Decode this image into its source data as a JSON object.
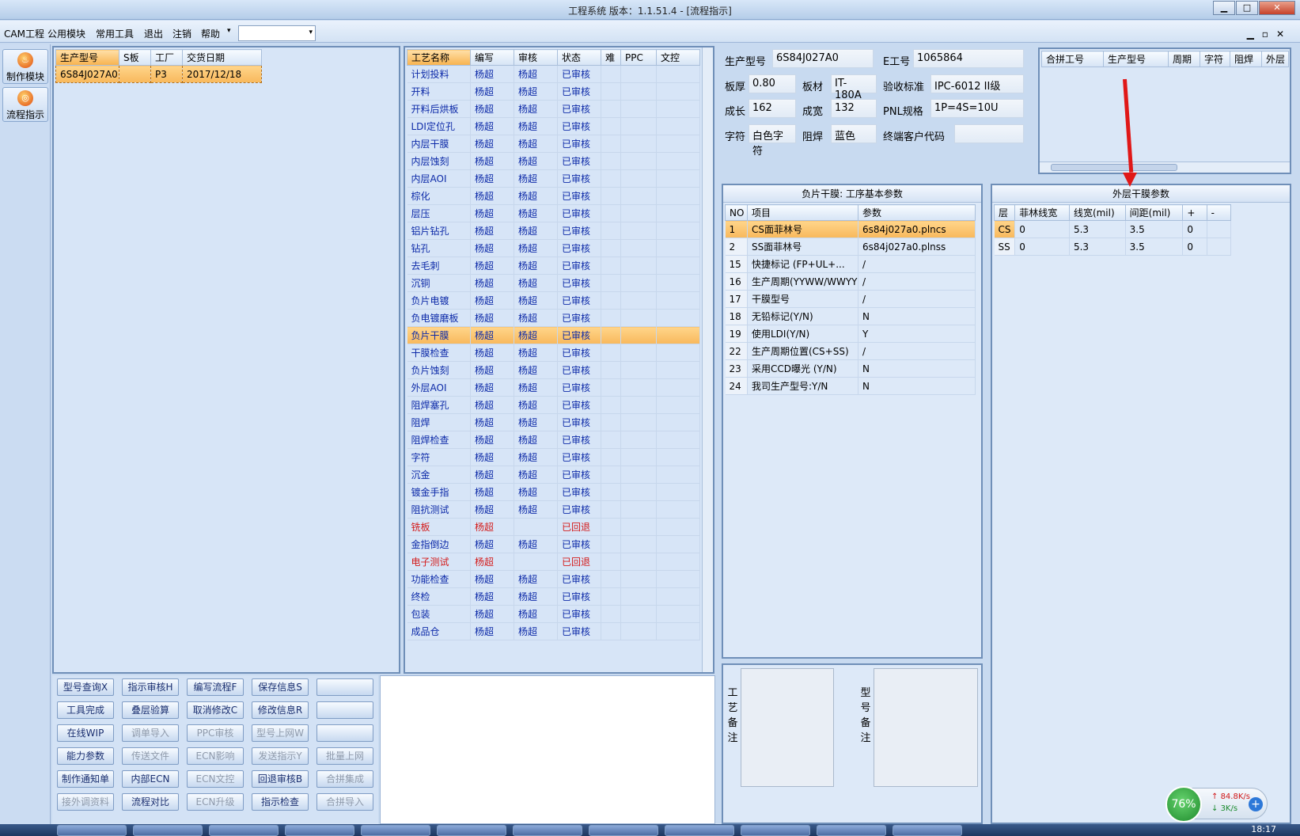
{
  "window": {
    "title": "工程系统   版本：1.1.51.4 - [流程指示]"
  },
  "menu": [
    "CAM工程",
    "公用模块",
    "常用工具",
    "退出",
    "注销",
    "帮助"
  ],
  "left_buttons": [
    "制作模块",
    "流程指示"
  ],
  "order_grid": {
    "headers": [
      "生产型号",
      "S板",
      "工厂",
      "交货日期"
    ],
    "row": [
      "6S84J027A0",
      "",
      "P3",
      "2017/12/18"
    ]
  },
  "process_grid": {
    "headers": [
      "工艺名称",
      "编写",
      "审核",
      "状态",
      "难",
      "PPC",
      "文控"
    ],
    "rows": [
      [
        "计划投料",
        "杨超",
        "杨超",
        "已审核"
      ],
      [
        "开料",
        "杨超",
        "杨超",
        "已审核"
      ],
      [
        "开料后烘板",
        "杨超",
        "杨超",
        "已审核"
      ],
      [
        "LDI定位孔",
        "杨超",
        "杨超",
        "已审核"
      ],
      [
        "内层干膜",
        "杨超",
        "杨超",
        "已审核"
      ],
      [
        "内层蚀刻",
        "杨超",
        "杨超",
        "已审核"
      ],
      [
        "内层AOI",
        "杨超",
        "杨超",
        "已审核"
      ],
      [
        "棕化",
        "杨超",
        "杨超",
        "已审核"
      ],
      [
        "层压",
        "杨超",
        "杨超",
        "已审核"
      ],
      [
        "铝片钻孔",
        "杨超",
        "杨超",
        "已审核"
      ],
      [
        "钻孔",
        "杨超",
        "杨超",
        "已审核"
      ],
      [
        "去毛刺",
        "杨超",
        "杨超",
        "已审核"
      ],
      [
        "沉铜",
        "杨超",
        "杨超",
        "已审核"
      ],
      [
        "负片电镀",
        "杨超",
        "杨超",
        "已审核"
      ],
      [
        "负电镀磨板",
        "杨超",
        "杨超",
        "已审核"
      ],
      [
        "负片干膜",
        "杨超",
        "杨超",
        "已审核"
      ],
      [
        "干膜检查",
        "杨超",
        "杨超",
        "已审核"
      ],
      [
        "负片蚀刻",
        "杨超",
        "杨超",
        "已审核"
      ],
      [
        "外层AOI",
        "杨超",
        "杨超",
        "已审核"
      ],
      [
        "阻焊塞孔",
        "杨超",
        "杨超",
        "已审核"
      ],
      [
        "阻焊",
        "杨超",
        "杨超",
        "已审核"
      ],
      [
        "阻焊检查",
        "杨超",
        "杨超",
        "已审核"
      ],
      [
        "字符",
        "杨超",
        "杨超",
        "已审核"
      ],
      [
        "沉金",
        "杨超",
        "杨超",
        "已审核"
      ],
      [
        "镀金手指",
        "杨超",
        "杨超",
        "已审核"
      ],
      [
        "阻抗测试",
        "杨超",
        "杨超",
        "已审核"
      ],
      [
        "铣板",
        "杨超",
        "",
        "已回退"
      ],
      [
        "金指倒边",
        "杨超",
        "杨超",
        "已审核"
      ],
      [
        "电子测试",
        "杨超",
        "",
        "已回退"
      ],
      [
        "功能检查",
        "杨超",
        "杨超",
        "已审核"
      ],
      [
        "终检",
        "杨超",
        "杨超",
        "已审核"
      ],
      [
        "包装",
        "杨超",
        "杨超",
        "已审核"
      ],
      [
        "成品仓",
        "杨超",
        "杨超",
        "已审核"
      ]
    ],
    "highlighted_index": 15,
    "returned_indexes": [
      26,
      28
    ]
  },
  "info": {
    "prod_model_label": "生产型号",
    "prod_model": "6S84J027A0",
    "e_no_label": "E工号",
    "e_no": "1065864",
    "thickness_label": "板厚",
    "thickness": "0.80",
    "material_label": "板材",
    "material": "IT-180A",
    "standard_label": "验收标准",
    "standard": "IPC-6012 II级",
    "length_label": "成长",
    "length": "162",
    "width_label": "成宽",
    "width": "132",
    "pnl_label": "PNL规格",
    "pnl": "1P=4S=10U",
    "char_label": "字符",
    "char": "白色字符",
    "mask_label": "阻焊",
    "mask": "蓝色",
    "customer_label": "终端客户代码",
    "customer": ""
  },
  "merge_grid": {
    "headers": [
      "合拼工号",
      "生产型号",
      "周期",
      "字符",
      "阻焊",
      "外层"
    ]
  },
  "param_panel": {
    "caption": "负片干膜: 工序基本参数",
    "headers": [
      "NO",
      "项目",
      "参数"
    ],
    "rows": [
      [
        "1",
        "CS面菲林号",
        "6s84j027a0.plncs"
      ],
      [
        "2",
        "SS面菲林号",
        "6s84j027a0.plnss"
      ],
      [
        "15",
        "快捷标记 (FP+UL+...",
        "/"
      ],
      [
        "16",
        "生产周期(YYWW/WWYY)",
        "/"
      ],
      [
        "17",
        "干膜型号",
        "/"
      ],
      [
        "18",
        "无铅标记(Y/N)",
        "N"
      ],
      [
        "19",
        "使用LDI(Y/N)",
        "Y"
      ],
      [
        "22",
        "生产周期位置(CS+SS)",
        "/"
      ],
      [
        "23",
        "采用CCD曝光 (Y/N)",
        "N"
      ],
      [
        "24",
        "我司生产型号:Y/N",
        "N"
      ]
    ]
  },
  "outer_panel": {
    "caption": "外层干膜参数",
    "headers": [
      "层",
      "菲林线宽",
      "线宽(mil)",
      "间距(mil)",
      "+",
      "-"
    ],
    "rows": [
      [
        "CS",
        "0",
        "5.3",
        "3.5",
        "0",
        ""
      ],
      [
        "SS",
        "0",
        "5.3",
        "3.5",
        "0",
        ""
      ]
    ]
  },
  "remarks": {
    "process_label": "工艺备注",
    "model_label": "型号备注"
  },
  "buttons": [
    [
      {
        "t": "型号查询X",
        "d": false
      },
      {
        "t": "指示审核H",
        "d": false
      },
      {
        "t": "编写流程F",
        "d": false
      },
      {
        "t": "保存信息S",
        "d": false
      },
      {
        "t": "",
        "d": false
      }
    ],
    [
      {
        "t": "工具完成",
        "d": false
      },
      {
        "t": "叠层验算",
        "d": false
      },
      {
        "t": "取消修改C",
        "d": false
      },
      {
        "t": "修改信息R",
        "d": false
      },
      {
        "t": "",
        "d": false
      }
    ],
    [
      {
        "t": "在线WIP",
        "d": false
      },
      {
        "t": "调单导入",
        "d": true
      },
      {
        "t": "PPC审核",
        "d": true
      },
      {
        "t": "型号上网W",
        "d": true
      },
      {
        "t": "",
        "d": false
      }
    ],
    [
      {
        "t": "能力参数",
        "d": false
      },
      {
        "t": "传送文件",
        "d": true
      },
      {
        "t": "ECN影响",
        "d": true
      },
      {
        "t": "发送指示Y",
        "d": true
      },
      {
        "t": "批量上网",
        "d": true
      }
    ],
    [
      {
        "t": "制作通知单",
        "d": false
      },
      {
        "t": "内部ECN",
        "d": false
      },
      {
        "t": "ECN文控",
        "d": true
      },
      {
        "t": "回退审核B",
        "d": false
      },
      {
        "t": "合拼集成",
        "d": true
      }
    ],
    [
      {
        "t": "接外调资料",
        "d": true
      },
      {
        "t": "流程对比",
        "d": false
      },
      {
        "t": "ECN升级",
        "d": true
      },
      {
        "t": "指示检查",
        "d": false
      },
      {
        "t": "合拼导入",
        "d": true
      }
    ]
  ],
  "network": {
    "percent": "76%",
    "up": "84.8K/s",
    "down": "3K/s"
  },
  "clock": "18:17"
}
